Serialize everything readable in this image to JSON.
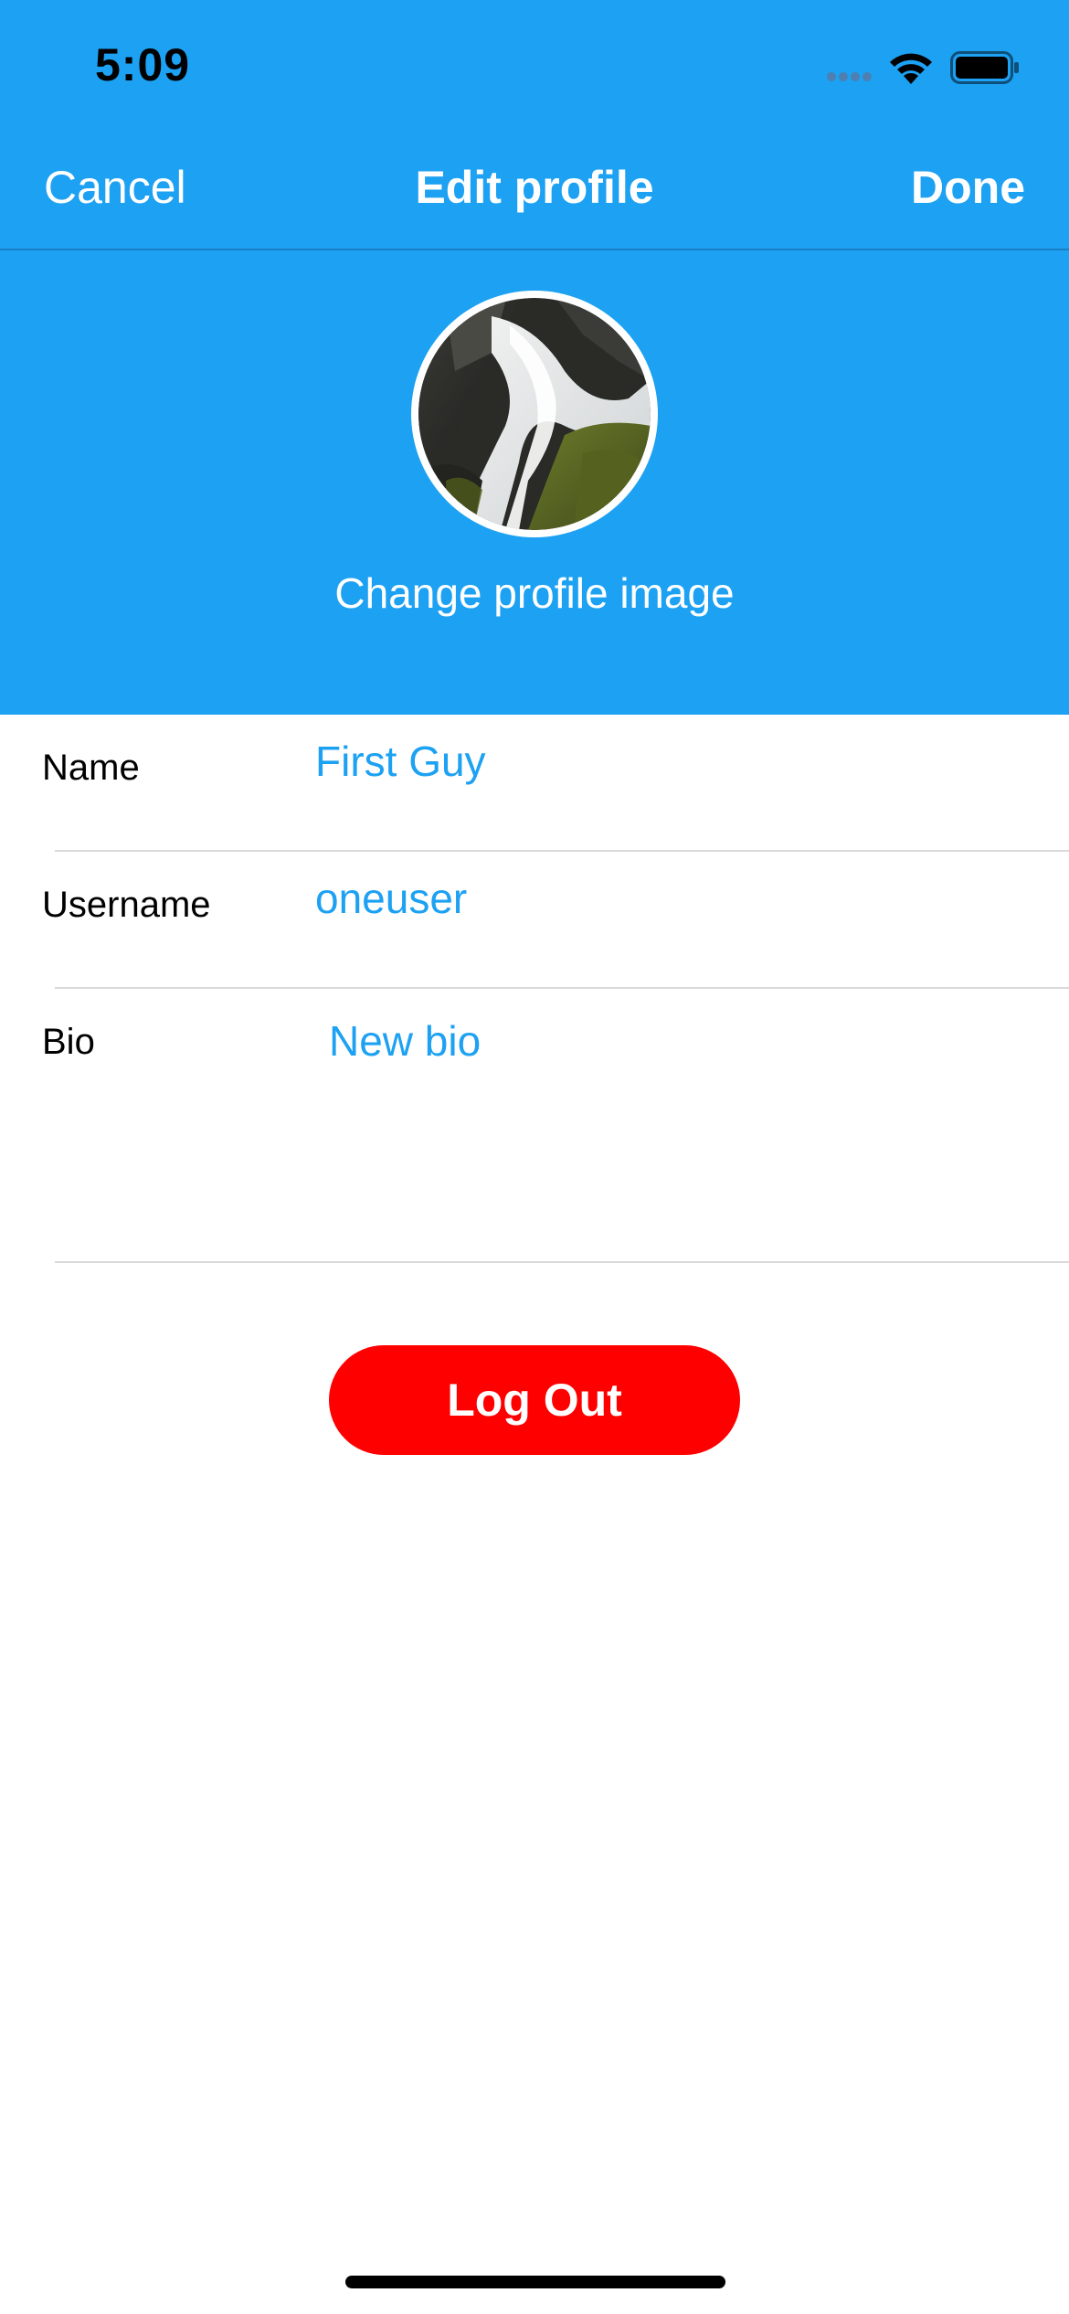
{
  "colors": {
    "header_bg": "#1da1f2",
    "accent": "#1da1f2",
    "logout_bg": "#ff0000"
  },
  "status_bar": {
    "time": "5:09",
    "icons": [
      "signal-icon",
      "wifi-icon",
      "battery-icon"
    ]
  },
  "nav": {
    "cancel_label": "Cancel",
    "title": "Edit profile",
    "done_label": "Done"
  },
  "profile": {
    "avatar_icon": "waterfall-photo",
    "change_image_label": "Change profile image"
  },
  "form": {
    "name": {
      "label": "Name",
      "value": "First Guy"
    },
    "username": {
      "label": "Username",
      "value": "oneuser"
    },
    "bio": {
      "label": "Bio",
      "value": "New bio"
    }
  },
  "logout_label": "Log Out"
}
